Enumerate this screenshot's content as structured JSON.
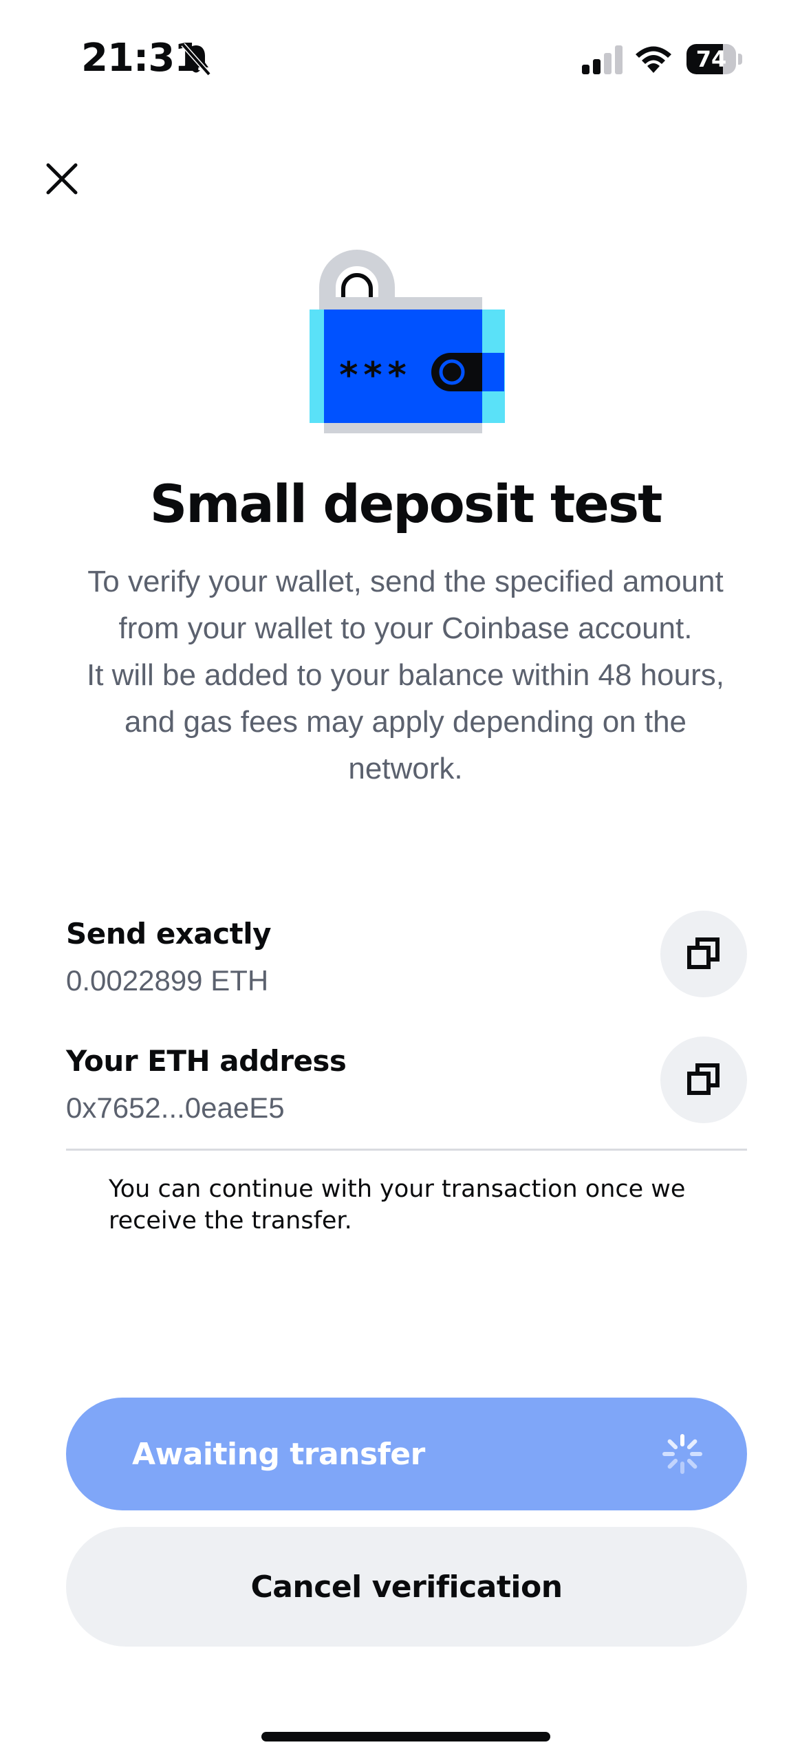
{
  "status_bar": {
    "time": "21:31",
    "battery_level": "74",
    "battery_fraction": 0.74,
    "icons": [
      "bell-muted-icon",
      "signal-icon",
      "wifi-icon",
      "battery-icon"
    ]
  },
  "header": {
    "close_icon": "close-icon"
  },
  "illustration": {
    "icon": "wallet-lock-illustration",
    "masked_text": "***",
    "colors": {
      "blue": "#0052ff",
      "cyan": "#5ae1f8",
      "gray": "#cfd2d8",
      "black": "#0a0b0d"
    }
  },
  "title": "Small deposit test",
  "description": {
    "line1": "To verify your wallet, send the specified amount from your wallet to your Coinbase account.",
    "line2": "It will be added to your balance within 48 hours, and gas fees may apply depending on the network."
  },
  "rows": [
    {
      "label": "Send exactly",
      "value": "0.0022899 ETH",
      "icon": "copy-icon"
    },
    {
      "label": "Your ETH address",
      "value": "0x7652...0eaeE5",
      "icon": "copy-icon"
    }
  ],
  "notice": "You can continue with your transaction once we receive the transfer.",
  "primary_button": {
    "label": "Awaiting transfer",
    "icon": "spinner-icon",
    "color": "#7fa6f8"
  },
  "secondary_button": {
    "label": "Cancel verification",
    "color": "#eef0f3"
  }
}
